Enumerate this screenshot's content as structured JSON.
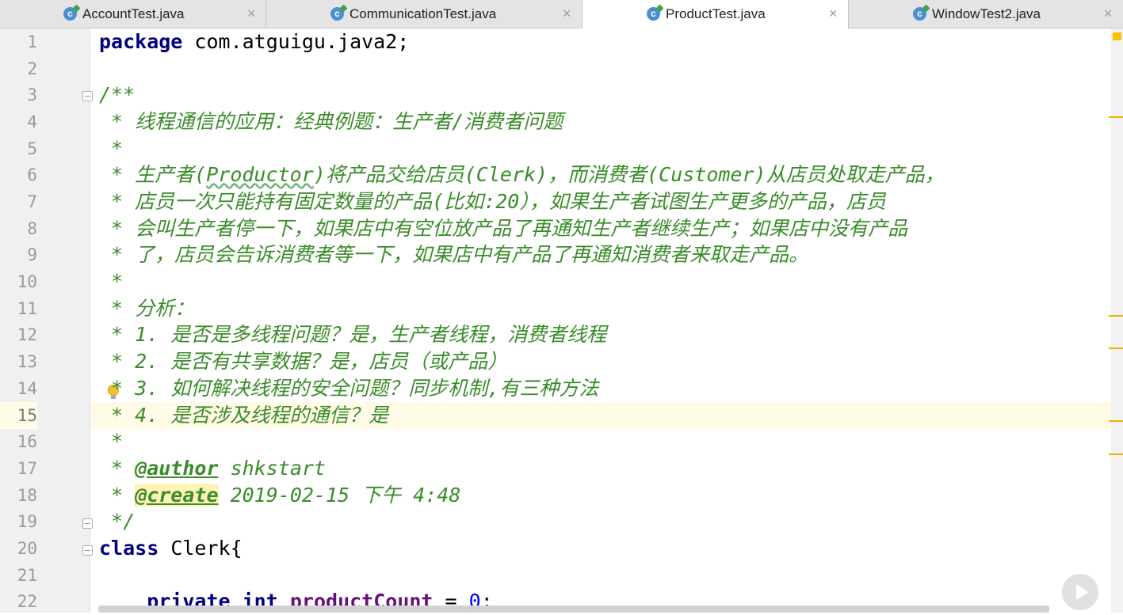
{
  "tabs": [
    {
      "label": "AccountTest.java",
      "close": "×",
      "icon": "java-class-icon",
      "active": false
    },
    {
      "label": "CommunicationTest.java",
      "close": "×",
      "icon": "java-class-icon",
      "active": false
    },
    {
      "label": "ProductTest.java",
      "close": "×",
      "icon": "java-class-icon",
      "active": true
    },
    {
      "label": "WindowTest2.java",
      "close": "×",
      "icon": "java-class-icon",
      "active": false
    }
  ],
  "editor": {
    "line_numbers": [
      "1",
      "2",
      "3",
      "4",
      "5",
      "6",
      "7",
      "8",
      "9",
      "10",
      "11",
      "12",
      "13",
      "14",
      "15",
      "16",
      "17",
      "18",
      "19",
      "20",
      "21",
      "22"
    ],
    "current_line": "15",
    "lines": {
      "l1_kw": "package",
      "l1_rest": " com.atguigu.java2;",
      "l3": "/**",
      "l4": " * 线程通信的应用：经典例题：生产者/消费者问题",
      "l5": " *",
      "l6_a": " * 生产者(",
      "l6_b": "Productor",
      "l6_c": ")将产品交给店员(Clerk)，而消费者(Customer)从店员处取走产品，",
      "l7": " * 店员一次只能持有固定数量的产品(比如:20），如果生产者试图生产更多的产品，店员",
      "l8": " * 会叫生产者停一下，如果店中有空位放产品了再通知生产者继续生产；如果店中没有产品",
      "l9": " * 了，店员会告诉消费者等一下，如果店中有产品了再通知消费者来取走产品。",
      "l10": " *",
      "l11": " * 分析：",
      "l12": " * 1. 是否是多线程问题？是，生产者线程，消费者线程",
      "l13": " * 2. 是否有共享数据？是，店员（或产品）",
      "l14": " * 3. 如何解决线程的安全问题？同步机制,有三种方法",
      "l15": " * 4. 是否涉及线程的通信？是",
      "l16": " *",
      "l17_pre": " * ",
      "l17_tag": "@author",
      "l17_val": " shkstart",
      "l18_pre": " * ",
      "l18_tag": "@create",
      "l18_val": " 2019-02-15 下午 4:48",
      "l19": " */",
      "l20_kw": "class",
      "l20_rest": " Clerk{",
      "l22_indent": "    ",
      "l22_kw": "private int",
      "l22_sp": " ",
      "l22_field": "productCount",
      "l22_eq": " = ",
      "l22_num": "0",
      "l22_end": ";"
    }
  },
  "colors": {
    "keyword": "#000080",
    "doc_comment": "#3a8c2a",
    "field": "#660e7a",
    "number": "#0000ff",
    "current_line_bg": "#fffbe6"
  }
}
